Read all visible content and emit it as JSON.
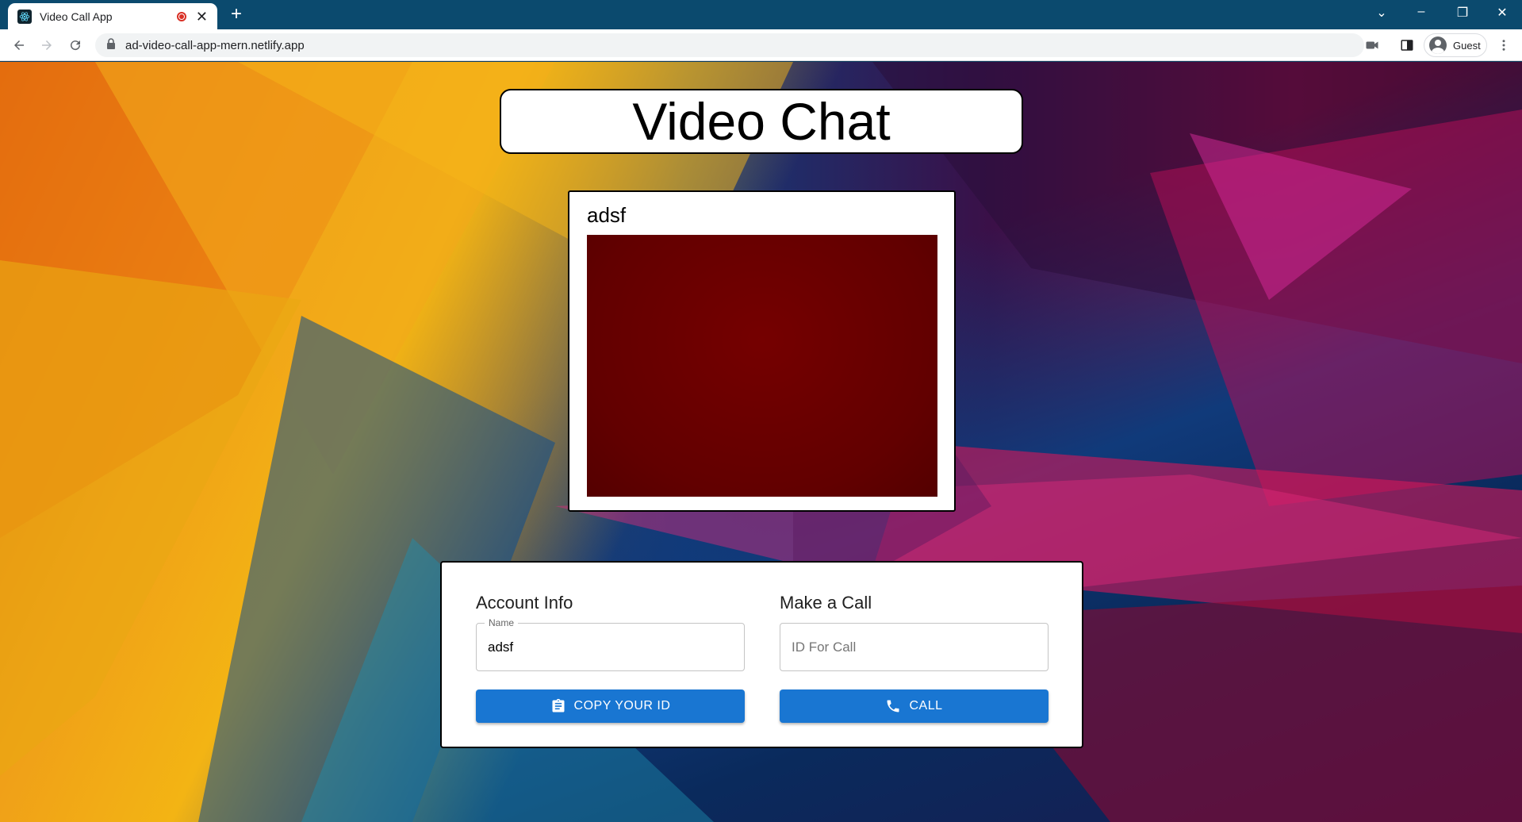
{
  "browser": {
    "tab_title": "Video Call App",
    "new_tab_label": "+",
    "url": "ad-video-call-app-mern.netlify.app",
    "profile_label": "Guest"
  },
  "page": {
    "title": "Video Chat",
    "video": {
      "name_label": "adsf"
    },
    "account": {
      "heading": "Account Info",
      "name_legend": "Name",
      "name_value": "adsf",
      "copy_button_label": "COPY YOUR ID"
    },
    "call": {
      "heading": "Make a Call",
      "id_placeholder": "ID For Call",
      "call_button_label": "CALL"
    }
  },
  "colors": {
    "tabbar": "#0b4a6e",
    "primary_button": "#1976d2",
    "video_feed": "#650000"
  }
}
